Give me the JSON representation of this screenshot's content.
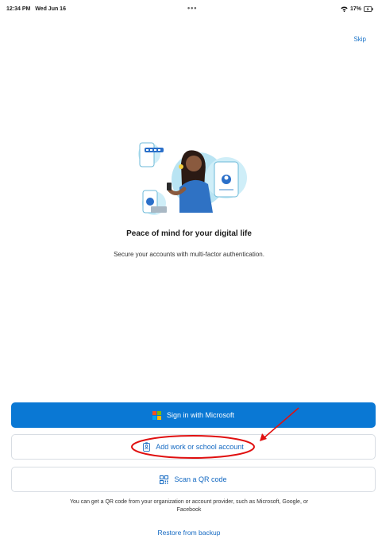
{
  "status_bar": {
    "time": "12:34 PM",
    "date": "Wed Jun 16",
    "battery": "17%"
  },
  "skip_label": "Skip",
  "hero": {
    "title": "Peace of mind for your digital life",
    "subtitle": "Secure your accounts with multi-factor authentication."
  },
  "buttons": {
    "sign_in_microsoft": "Sign in with Microsoft",
    "add_work_school": "Add work or school account",
    "scan_qr": "Scan a QR code"
  },
  "qr_note": "You can get a QR code from your organization or account provider, such as Microsoft, Google, or Facebook",
  "restore_label": "Restore from backup",
  "colors": {
    "accent": "#0a78d4",
    "link": "#1469c2",
    "annotation": "#e01010"
  },
  "icons": [
    "wifi-icon",
    "battery-icon",
    "microsoft-logo-icon",
    "id-badge-icon",
    "qr-code-icon"
  ]
}
